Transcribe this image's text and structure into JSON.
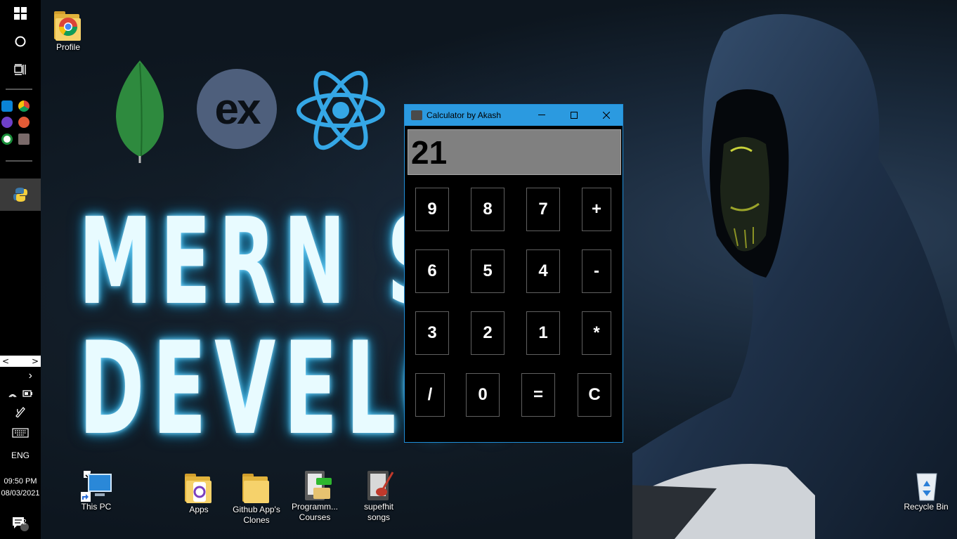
{
  "desktop": {
    "wallpaper_text": [
      "MERN ST",
      "DEVELOP"
    ],
    "logo_text_express": "ex",
    "icons": [
      {
        "label": "Profile"
      },
      {
        "label": "This PC"
      },
      {
        "label": "Apps"
      },
      {
        "label": "Github App's\nClones"
      },
      {
        "label": "Programm...\nCourses"
      },
      {
        "label": "supefhit\nsongs"
      },
      {
        "label": "Recycle Bin"
      }
    ]
  },
  "taskbar": {
    "language": "ENG",
    "time": "09:50 PM",
    "date": "08/03/2021",
    "notification_count": "2",
    "scroll_left": "<",
    "scroll_right": ">",
    "chevron": "›"
  },
  "calculator": {
    "title": "Calculator by Akash",
    "display_value": "21",
    "window_buttons": {
      "minimize": "—",
      "maximize": "☐",
      "close": "✕"
    },
    "keys": [
      [
        "9",
        "8",
        "7",
        "+"
      ],
      [
        "6",
        "5",
        "4",
        "-"
      ],
      [
        "3",
        "2",
        "1",
        "*"
      ],
      [
        "/",
        "0",
        "=",
        "C"
      ]
    ]
  },
  "colors": {
    "titlebar": "#2b9ae0",
    "display_bg": "#808080",
    "react": "#35a7e6",
    "mongo": "#2e8a3e"
  }
}
